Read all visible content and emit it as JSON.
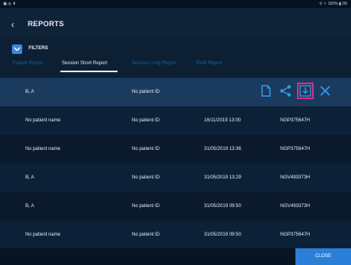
{
  "status": {
    "left": "▣ ◎ ⬆",
    "right": "⚲ ✧ 100% ▮ 09:"
  },
  "header": {
    "back_icon": "chevron-left-icon",
    "title": "REPORTS"
  },
  "filters": {
    "label": "FILTERS"
  },
  "tabs": [
    {
      "label": "Patient Report",
      "active": false
    },
    {
      "label": "Session Short Report",
      "active": true
    },
    {
      "label": "Session Long Report",
      "active": false
    },
    {
      "label": "Refill Report",
      "active": false
    }
  ],
  "rows": [
    {
      "name": "B, A",
      "id": "No patient ID",
      "date": "",
      "serial": "",
      "selected": true
    },
    {
      "name": "No patient name",
      "id": "No patient ID",
      "date": "16/11/2019 13:00",
      "serial": "NGP375647H"
    },
    {
      "name": "No patient name",
      "id": "No patient ID",
      "date": "31/05/2019 13:36",
      "serial": "NGP375647H"
    },
    {
      "name": "B, A",
      "id": "No patient ID",
      "date": "31/05/2019 13:29",
      "serial": "NGV493373H"
    },
    {
      "name": "B, A",
      "id": "No patient ID",
      "date": "31/05/2019 09:50",
      "serial": "NGV493373H"
    },
    {
      "name": "No patient name",
      "id": "No patient ID",
      "date": "31/05/2019 09:50",
      "serial": "NGP375647H"
    }
  ],
  "actions": [
    "document-icon",
    "share-icon",
    "download-icon",
    "close-icon"
  ],
  "close_button": "CLOSE",
  "colors": {
    "accent": "#2c7fd8",
    "highlight": "#d92c8a"
  }
}
